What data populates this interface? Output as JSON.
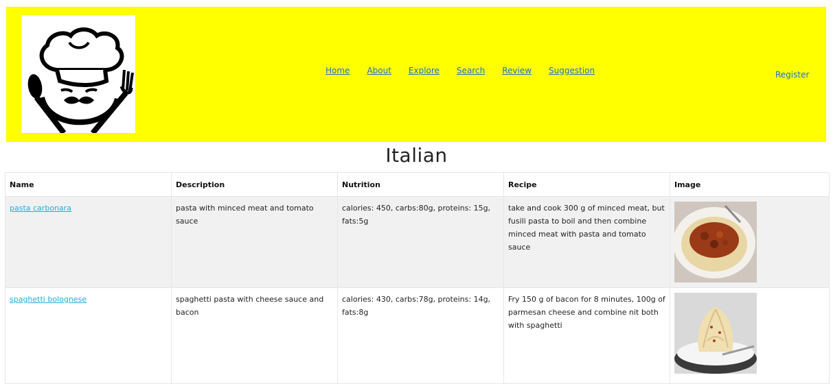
{
  "header": {
    "background": "#ffff00",
    "logo": "chef-hat-logo",
    "nav": [
      "Home",
      "About",
      "Explore",
      "Search",
      "Review",
      "Suggestion"
    ],
    "register": "Register"
  },
  "page_title": "Italian",
  "table": {
    "headers": [
      "Name",
      "Description",
      "Nutrition",
      "Recipe",
      "Image"
    ],
    "rows": [
      {
        "name": "pasta carbonara",
        "description": "pasta with minced meat and tomato sauce",
        "nutrition": "calories: 450, carbs:80g, proteins: 15g, fats:5g",
        "recipe": "take and cook 300 g of minced meat, but fusili pasta to boil and then combine minced meat with pasta and tomato sauce",
        "image": "spaghetti-bolognese-photo"
      },
      {
        "name": "spaghetti bolognese",
        "description": "spaghetti pasta with cheese sauce and bacon",
        "nutrition": "calories: 430, carbs:78g, proteins: 14g, fats:8g",
        "recipe": "Fry 150 g of bacon for 8 minutes, 100g of parmesan cheese and combine nit both with spaghetti",
        "image": "spaghetti-carbonara-photo"
      }
    ]
  }
}
